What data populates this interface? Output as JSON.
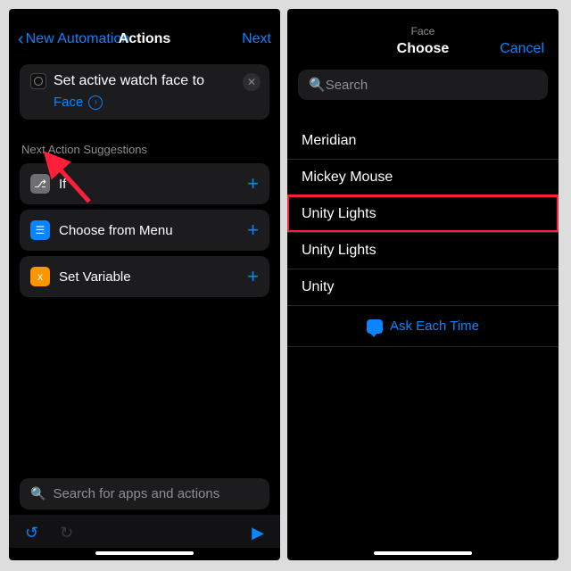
{
  "left": {
    "nav": {
      "back": "New Automation",
      "title": "Actions",
      "next": "Next"
    },
    "card": {
      "text": "Set active watch face to",
      "token": "Face"
    },
    "section_label": "Next Action Suggestions",
    "suggestions": [
      {
        "label": "If"
      },
      {
        "label": "Choose from Menu"
      },
      {
        "label": "Set Variable"
      }
    ],
    "search_placeholder": "Search for apps and actions"
  },
  "right": {
    "super": "Face",
    "title": "Choose",
    "cancel": "Cancel",
    "search_placeholder": "Search",
    "options": [
      {
        "label": "Meridian",
        "highlight": false
      },
      {
        "label": "Mickey Mouse",
        "highlight": false
      },
      {
        "label": "Unity Lights",
        "highlight": true
      },
      {
        "label": "Unity Lights",
        "highlight": false
      },
      {
        "label": "Unity",
        "highlight": false
      }
    ],
    "ask": "Ask Each Time"
  }
}
